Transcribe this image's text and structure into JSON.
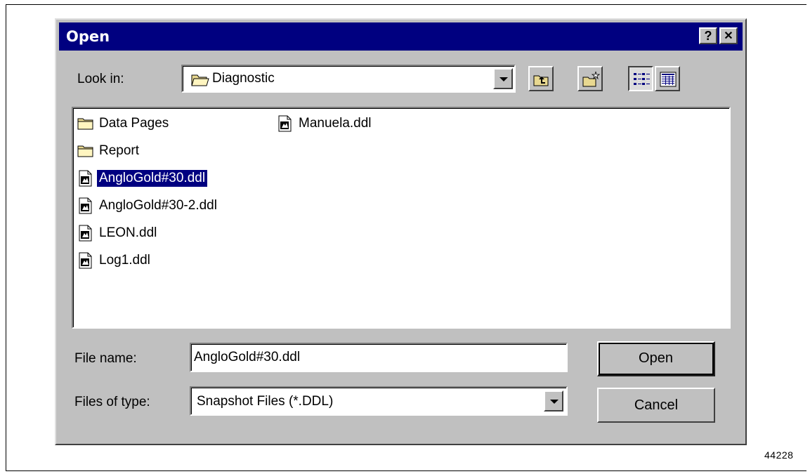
{
  "dialog": {
    "title": "Open",
    "help_glyph": "?",
    "close_glyph": "✕"
  },
  "look_in": {
    "label": "Look in:",
    "value": "Diagnostic",
    "icon": "folder-icon"
  },
  "toolbar": {
    "buttons": [
      {
        "name": "up-one-level",
        "icon": "folder-up-icon"
      },
      {
        "name": "create-new-folder",
        "icon": "new-folder-icon"
      },
      {
        "name": "list-view",
        "icon": "list-view-icon",
        "pressed": true
      },
      {
        "name": "details-view",
        "icon": "details-view-icon",
        "pressed": false
      }
    ]
  },
  "files": [
    {
      "name": "Data Pages",
      "type": "folder"
    },
    {
      "name": "Report",
      "type": "folder"
    },
    {
      "name": "AngloGold#30.ddl",
      "type": "ddl",
      "selected": true
    },
    {
      "name": "AngloGold#30-2.ddl",
      "type": "ddl"
    },
    {
      "name": "LEON.ddl",
      "type": "ddl"
    },
    {
      "name": "Log1.ddl",
      "type": "ddl"
    },
    {
      "name": "Manuela.ddl",
      "type": "ddl"
    }
  ],
  "file_name": {
    "label": "File name:",
    "value": "AngloGold#30.ddl"
  },
  "file_type": {
    "label": "Files of type:",
    "value": "Snapshot Files (*.DDL)"
  },
  "buttons": {
    "open": "Open",
    "cancel": "Cancel"
  },
  "figure_number": "44228",
  "colors": {
    "titlebar": "#000080",
    "dialog_face": "#c0c0c0",
    "selection": "#000080"
  }
}
